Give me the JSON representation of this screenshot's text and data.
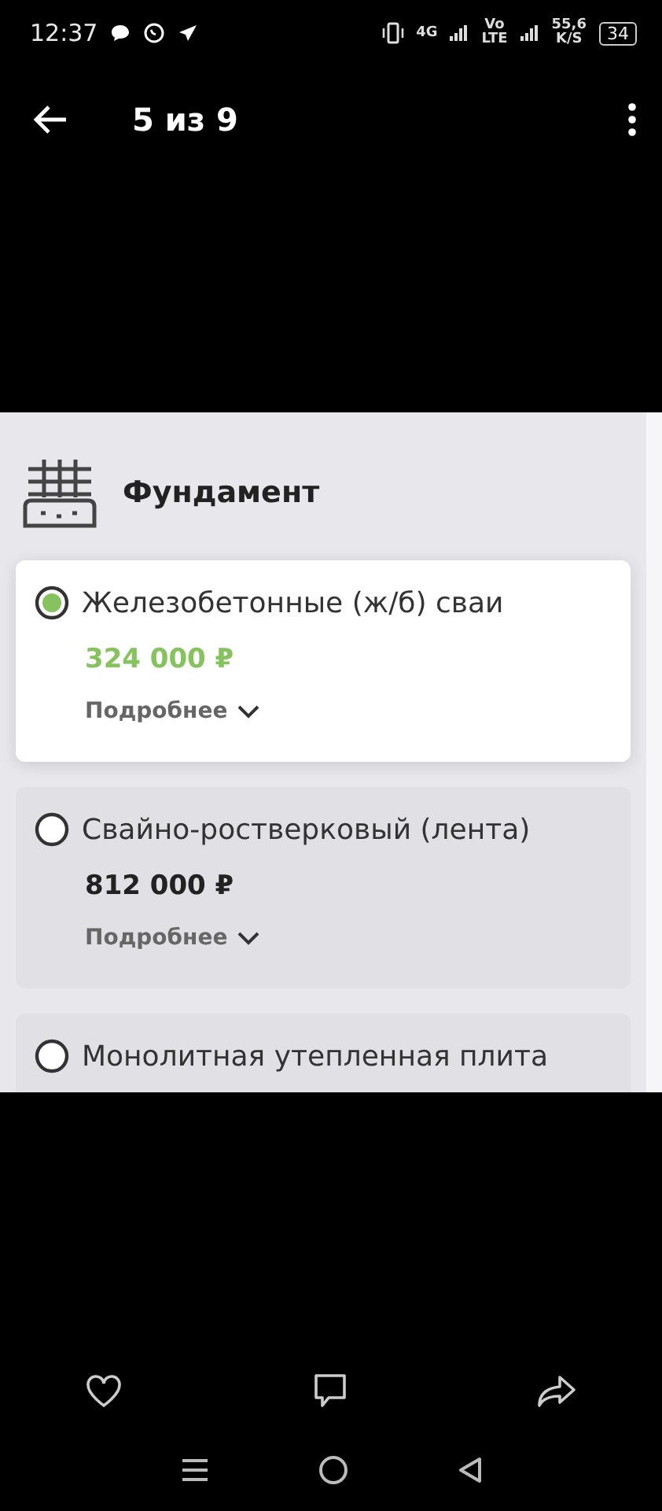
{
  "status_bar": {
    "time": "12:37",
    "network": "4G",
    "volte_top": "Vo",
    "volte_bottom": "LTE",
    "speed": "55,6",
    "speed_unit": "K/S",
    "battery": "34"
  },
  "toolbar": {
    "counter": "5 из 9"
  },
  "image": {
    "section_title": "Фундамент",
    "options": [
      {
        "title": "Железобетонные (ж/б) сваи",
        "price": "324 000 ₽",
        "details": "Подробнее",
        "selected": true
      },
      {
        "title": "Свайно-ростверковый (лента)",
        "price": "812 000 ₽",
        "details": "Подробнее",
        "selected": false
      },
      {
        "title": "Монолитная утепленная плита",
        "selected": false
      }
    ]
  }
}
